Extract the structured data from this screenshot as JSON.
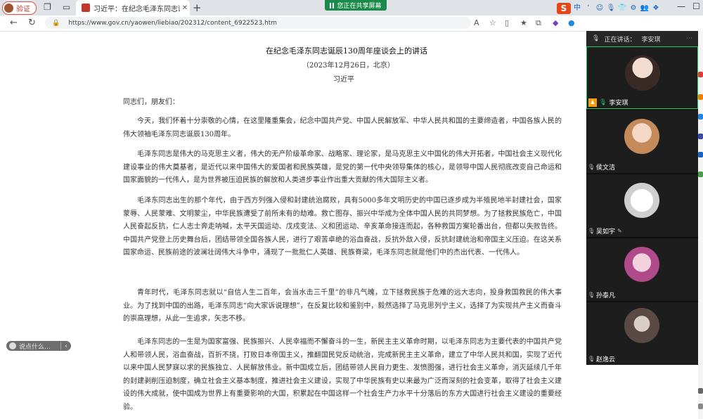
{
  "tabbar": {
    "profile_label": "验证",
    "active_tab_title": "习近平：在纪念毛泽东同志诞辰",
    "share_label": "您正在共享屏幕",
    "ime_logo": "S",
    "ime_items": [
      "中",
      "ʻ",
      "☺",
      "🎙",
      "👕",
      "⚙",
      "👥",
      "❖"
    ]
  },
  "addressbar": {
    "url": "https://www.gov.cn/yaowen/liebiao/202312/content_6922523.htm"
  },
  "article": {
    "title": "在纪念毛泽东同志诞辰130周年座谈会上的讲话",
    "date": "（2023年12月26日，北京）",
    "author": "习近平",
    "salutation": "同志们，朋友们：",
    "paragraphs": [
      "今天，我们怀着十分崇敬的心情，在这里隆重集会，纪念中国共产党、中国人民解放军、中华人民共和国的主要缔造者，中国各族人民的伟大领袖毛泽东同志诞辰130周年。",
      "毛泽东同志是伟大的马克思主义者，伟大的无产阶级革命家、战略家、理论家，是马克思主义中国化的伟大开拓者，中国社会主义现代化建设事业的伟大奠基者，是近代以来中国伟大的爱国者和民族英雄，是党的第一代中央领导集体的核心，是领导中国人民彻底改变自己命运和国家面貌的一代伟人，是为世界被压迫民族的解放和人类进步事业作出重大贡献的伟大国际主义者。",
      "毛泽东同志出生的那个年代，由于西方列强入侵和封建统治腐败，具有5000多年文明历史的中国已逐步成为半殖民地半封建社会，国家蒙辱、人民蒙难、文明蒙尘，中华民族遭受了前所未有的劫难。救亡图存、振兴中华成为全体中国人民的共同梦想。为了拯救民族危亡，中国人民奋起反抗，仁人志士奔走呐喊，太平天国运动、戊戌变法、义和团运动、辛亥革命接连而起，各种救国方案轮番出台，但都以失败告终。中国共产党登上历史舞台后，团结带领全国各族人民，进行了艰苦卓绝的浴血奋战，反抗外敌入侵，反抗封建统治和帝国主义压迫。在这关系国家命运、民族前途的波澜壮阔伟大斗争中，涌现了一批批仁人英雄、民族脊梁，毛泽东同志就是他们中的杰出代表、一代伟人。",
      "青年时代，毛泽东同志就以“自信人生二百年，会当水击三千里”的非凡气魄，立下拯救民族于危难的远大志向，投身救国救民的伟大事业。为了找到中国的出路，毛泽东同志“向大家诉说理想”，在反复比较和鉴别中，毅然选择了马克思列宁主义，选择了为实现共产主义而奋斗的崇高理想，从此一生追求，矢志不移。",
      "毛泽东同志的一生是为国家富强、民族振兴、人民幸福而不懈奋斗的一生，新民主主义革命时期，以毛泽东同志为主要代表的中国共产党人和带领人民，浴血奋战，百折不挠，打败日本帝国主义，推翻国民党反动统治，完成新民主主义革命，建立了中华人民共和国，实现了近代以来中国人民梦寐以求的民族独立、人民解放伟业。新中国成立后，团结带领人民自力更生、发愤图强，进行社会主义革命，消灭延续几千年的封建剥削压迫制度，确立社会主义基本制度，推进社会主义建设，实现了中华民族有史以来最为广泛而深刻的社会变革，取得了社会主义建设的伟大成就，使中国成为世界上有重要影响的大国，积累起在中国这样一个社会生产力水平十分落后的东方大国进行社会主义建设的重要经验。"
    ],
    "chat_placeholder": "说点什么…"
  },
  "meeting": {
    "header_label": "正在讲话：",
    "speaker": "李安琪",
    "participants": [
      {
        "name": "李安琪",
        "host": true,
        "active": true
      },
      {
        "name": "侯文洁",
        "host": false,
        "active": false
      },
      {
        "name": "吴如宇",
        "host": false,
        "active": false
      },
      {
        "name": "孙泰凡",
        "host": false,
        "active": false
      },
      {
        "name": "赵逸云",
        "host": false,
        "active": false
      }
    ]
  },
  "colors": {
    "share_green": "#1a8a4a",
    "ime_orange": "#e4471a",
    "active_border": "#22c55e"
  }
}
